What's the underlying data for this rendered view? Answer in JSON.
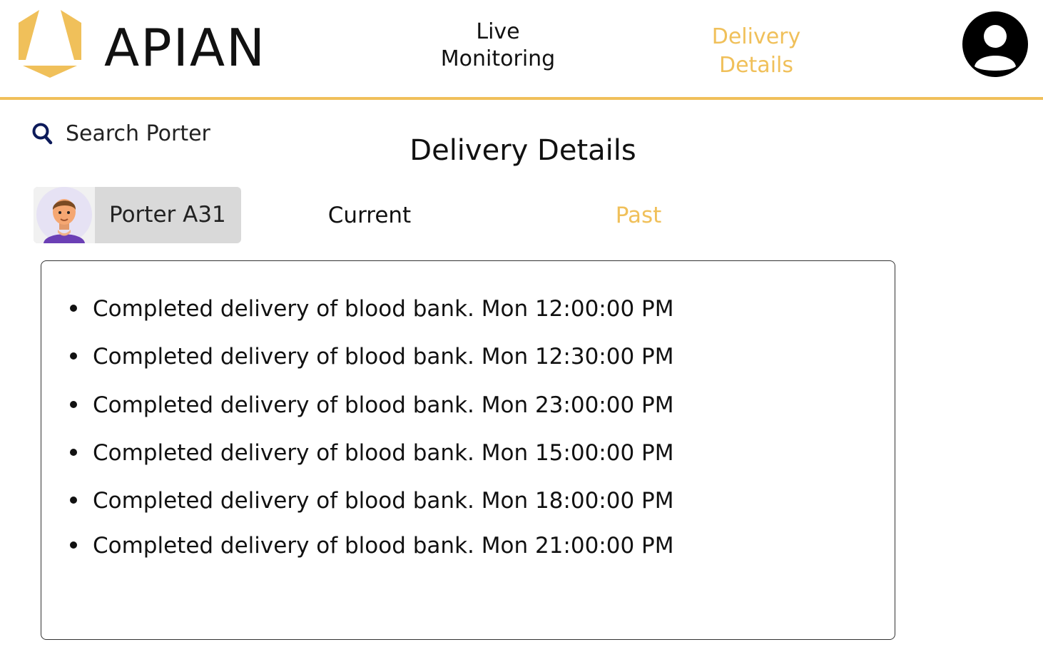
{
  "header": {
    "brand": "APIAN",
    "nav": {
      "live_monitoring": "Live\nMonitoring",
      "delivery_details": "Delivery\nDetails"
    },
    "profile_icon": "user-circle-icon"
  },
  "search": {
    "icon": "search-icon",
    "placeholder": "Search Porter"
  },
  "page_title": "Delivery Details",
  "porter": {
    "name": "Porter A31",
    "avatar": "avatar"
  },
  "tabs": {
    "current": "Current",
    "past": "Past"
  },
  "deliveries": [
    "Completed delivery of blood bank. Mon 12:00:00 PM",
    "Completed delivery of blood bank. Mon 12:30:00 PM",
    "Completed delivery of blood bank. Mon 23:00:00 PM",
    "Completed delivery of blood bank. Mon 15:00:00 PM",
    "Completed delivery of blood bank. Mon 18:00:00 PM",
    "Completed delivery of blood bank. Mon 21:00:00 PM"
  ],
  "colors": {
    "accent": "#f0c05a",
    "text": "#111111",
    "chip_bg": "#d9d9d9"
  }
}
